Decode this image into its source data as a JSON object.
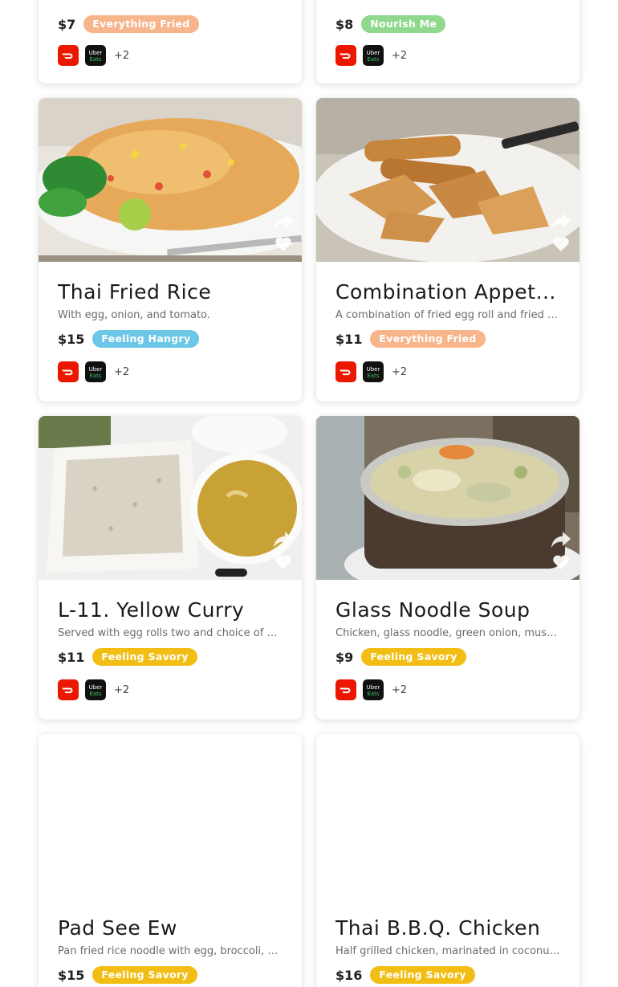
{
  "providers": {
    "doordash_icon": "doordash-logo-icon",
    "ubereats_icon": "ubereats-logo-icon",
    "ubereats_text_1": "Uber",
    "ubereats_text_2": "Eats"
  },
  "colors": {
    "everything_fried": "#f7b58c",
    "nourish_me": "#8fd88e",
    "feeling_hangry": "#6cc7e6",
    "feeling_savory": "#f2be15",
    "doordash_red": "#eb1700"
  },
  "top_cards": [
    {
      "price": "$7",
      "badge": "Everything Fried",
      "more": "+2"
    },
    {
      "price": "$8",
      "badge": "Nourish Me",
      "more": "+2"
    }
  ],
  "cards": [
    {
      "title": "Thai Fried Rice",
      "description": "With egg, onion, and tomato.",
      "price": "$15",
      "badge": "Feeling Hangry",
      "more": "+2"
    },
    {
      "title": "Combination Appetizer",
      "description": "A combination of fried egg roll and fried wonton.",
      "price": "$11",
      "badge": "Everything Fried",
      "more": "+2"
    },
    {
      "title": "L-11. Yellow Curry",
      "description": "Served with egg rolls two and choice of soup or salad.",
      "price": "$11",
      "badge": "Feeling Savory",
      "more": "+2"
    },
    {
      "title": "Glass Noodle Soup",
      "description": "Chicken, glass noodle, green onion, mushroom.",
      "price": "$9",
      "badge": "Feeling Savory",
      "more": "+2"
    },
    {
      "title": "Pad See Ew",
      "description": "Pan fried rice noodle with egg, broccoli, and carrot.",
      "price": "$15",
      "badge": "Feeling Savory"
    },
    {
      "title": "Thai B.B.Q. Chicken",
      "description": "Half grilled chicken, marinated in coconut milk.",
      "price": "$16",
      "badge": "Feeling Savory"
    }
  ]
}
